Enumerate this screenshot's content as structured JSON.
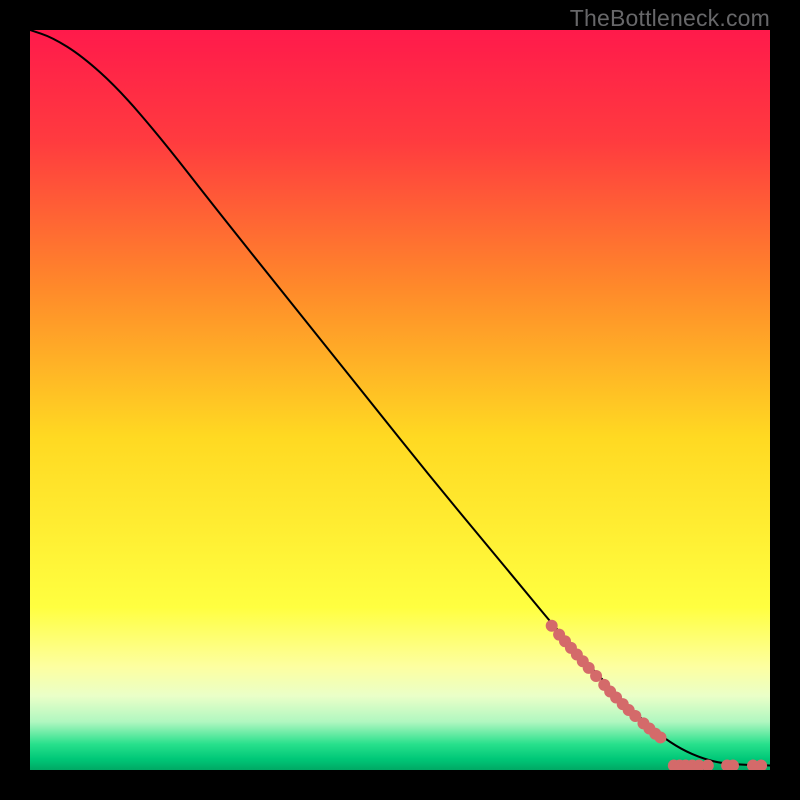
{
  "watermark": "TheBottleneck.com",
  "chart_data": {
    "type": "line",
    "title": "",
    "xlabel": "",
    "ylabel": "",
    "xlim": [
      0,
      100
    ],
    "ylim": [
      0,
      100
    ],
    "background_gradient": {
      "stops": [
        {
          "offset": 0,
          "color": "#ff1a4b"
        },
        {
          "offset": 0.15,
          "color": "#ff3b3f"
        },
        {
          "offset": 0.35,
          "color": "#ff8a2a"
        },
        {
          "offset": 0.55,
          "color": "#ffd922"
        },
        {
          "offset": 0.78,
          "color": "#ffff40"
        },
        {
          "offset": 0.86,
          "color": "#fdffa0"
        },
        {
          "offset": 0.9,
          "color": "#eaffc8"
        },
        {
          "offset": 0.935,
          "color": "#b0f7c0"
        },
        {
          "offset": 0.965,
          "color": "#28e08c"
        },
        {
          "offset": 0.985,
          "color": "#00c878"
        },
        {
          "offset": 1.0,
          "color": "#00a864"
        }
      ]
    },
    "curve": [
      {
        "x": 0,
        "y": 100
      },
      {
        "x": 3,
        "y": 99.0
      },
      {
        "x": 7,
        "y": 96.5
      },
      {
        "x": 12,
        "y": 92.0
      },
      {
        "x": 18,
        "y": 85.0
      },
      {
        "x": 25,
        "y": 76.0
      },
      {
        "x": 35,
        "y": 63.5
      },
      {
        "x": 45,
        "y": 51.0
      },
      {
        "x": 55,
        "y": 38.5
      },
      {
        "x": 65,
        "y": 26.5
      },
      {
        "x": 72,
        "y": 18.0
      },
      {
        "x": 78,
        "y": 11.5
      },
      {
        "x": 82,
        "y": 7.5
      },
      {
        "x": 85,
        "y": 4.8
      },
      {
        "x": 88,
        "y": 2.8
      },
      {
        "x": 91,
        "y": 1.5
      },
      {
        "x": 94,
        "y": 0.8
      },
      {
        "x": 100,
        "y": 0.6
      }
    ],
    "dots": {
      "color": "#d46a6a",
      "radius": 6,
      "points": [
        {
          "x": 70.5,
          "y": 19.5
        },
        {
          "x": 71.5,
          "y": 18.3
        },
        {
          "x": 72.3,
          "y": 17.4
        },
        {
          "x": 73.1,
          "y": 16.5
        },
        {
          "x": 73.9,
          "y": 15.6
        },
        {
          "x": 74.7,
          "y": 14.7
        },
        {
          "x": 75.5,
          "y": 13.8
        },
        {
          "x": 76.5,
          "y": 12.7
        },
        {
          "x": 77.6,
          "y": 11.5
        },
        {
          "x": 78.4,
          "y": 10.6
        },
        {
          "x": 79.2,
          "y": 9.8
        },
        {
          "x": 80.1,
          "y": 8.9
        },
        {
          "x": 80.9,
          "y": 8.1
        },
        {
          "x": 81.8,
          "y": 7.3
        },
        {
          "x": 82.9,
          "y": 6.3
        },
        {
          "x": 83.7,
          "y": 5.6
        },
        {
          "x": 84.5,
          "y": 4.9
        },
        {
          "x": 85.2,
          "y": 4.4
        },
        {
          "x": 87.0,
          "y": 0.6
        },
        {
          "x": 87.8,
          "y": 0.6
        },
        {
          "x": 88.6,
          "y": 0.6
        },
        {
          "x": 89.5,
          "y": 0.6
        },
        {
          "x": 90.4,
          "y": 0.6
        },
        {
          "x": 91.6,
          "y": 0.6
        },
        {
          "x": 94.2,
          "y": 0.6
        },
        {
          "x": 95.0,
          "y": 0.6
        },
        {
          "x": 97.7,
          "y": 0.6
        },
        {
          "x": 98.8,
          "y": 0.6
        }
      ]
    }
  }
}
